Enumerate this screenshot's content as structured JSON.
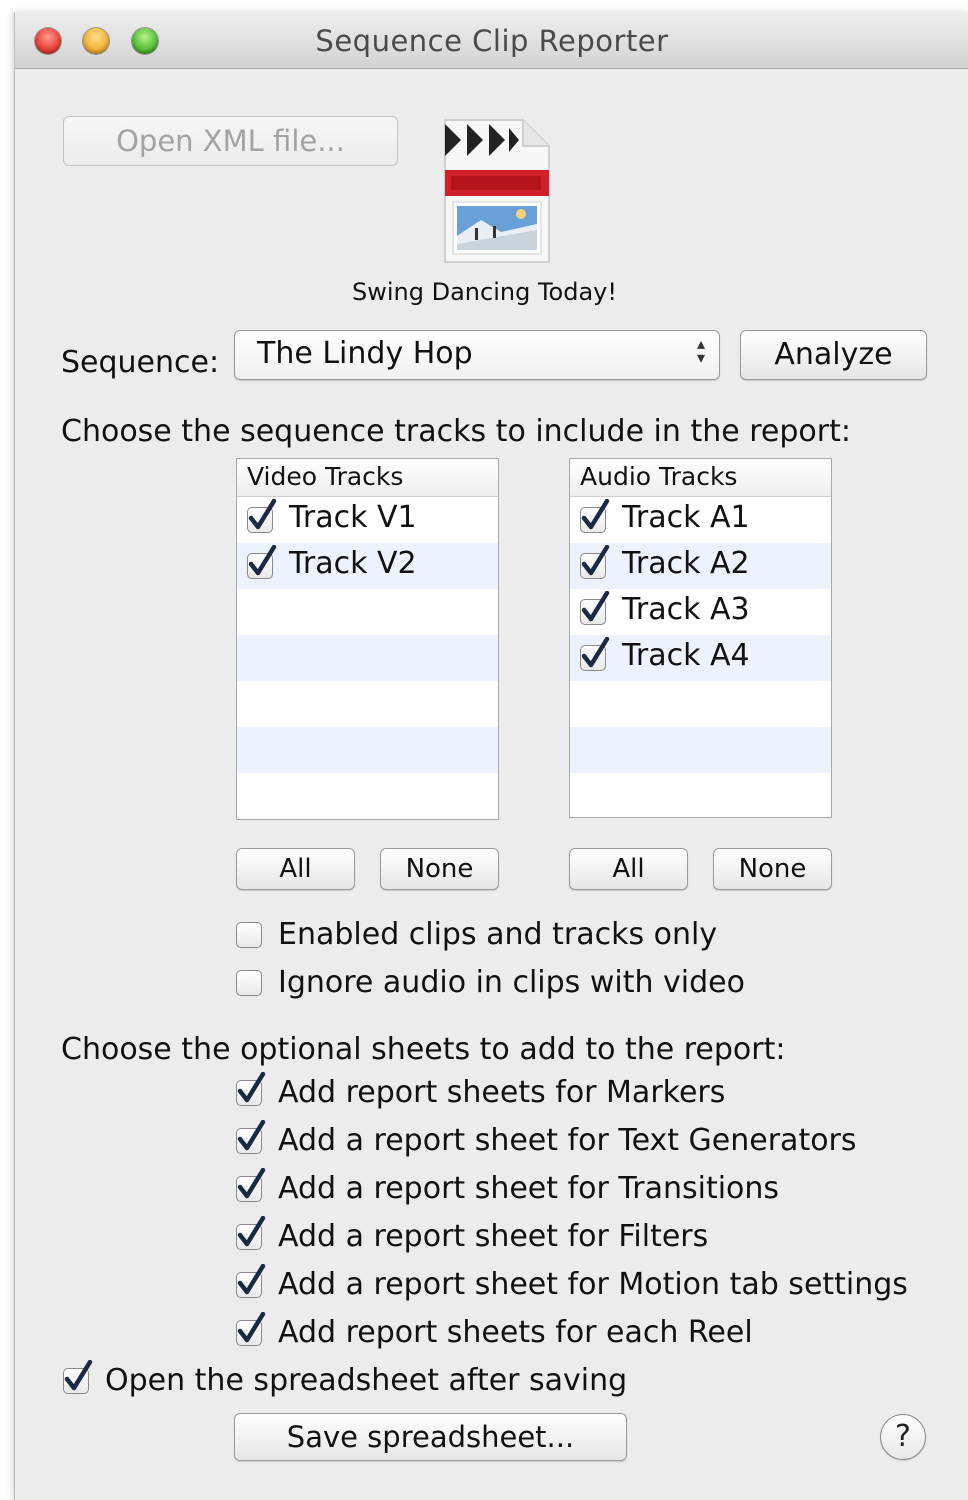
{
  "window": {
    "title": "Sequence Clip Reporter"
  },
  "open_xml_button": "Open XML file...",
  "file": {
    "name": "Swing Dancing Today!",
    "icon": "final-cut-project-file-icon"
  },
  "sequence": {
    "label": "Sequence:",
    "selected": "The Lindy Hop",
    "analyze_label": "Analyze"
  },
  "tracks_prompt": "Choose the sequence tracks to include in the report:",
  "video_tracks": {
    "header": "Video Tracks",
    "items": [
      {
        "label": "Track V1",
        "checked": true
      },
      {
        "label": "Track V2",
        "checked": true
      }
    ],
    "all_label": "All",
    "none_label": "None"
  },
  "audio_tracks": {
    "header": "Audio Tracks",
    "items": [
      {
        "label": "Track A1",
        "checked": true
      },
      {
        "label": "Track A2",
        "checked": true
      },
      {
        "label": "Track A3",
        "checked": true
      },
      {
        "label": "Track A4",
        "checked": true
      }
    ],
    "all_label": "All",
    "none_label": "None"
  },
  "options": {
    "enabled_only": {
      "label": "Enabled clips and tracks only",
      "checked": false
    },
    "ignore_audio": {
      "label": "Ignore audio in clips with video",
      "checked": false
    }
  },
  "sheets_prompt": "Choose the optional sheets to add to the report:",
  "sheets": [
    {
      "label": "Add report sheets for Markers",
      "checked": true
    },
    {
      "label": "Add a report sheet for Text Generators",
      "checked": true
    },
    {
      "label": "Add a report sheet for Transitions",
      "checked": true
    },
    {
      "label": "Add a report sheet for Filters",
      "checked": true
    },
    {
      "label": "Add a report sheet for Motion tab settings",
      "checked": true
    },
    {
      "label": "Add report sheets for each Reel",
      "checked": true
    }
  ],
  "open_after_saving": {
    "label": "Open the spreadsheet after saving",
    "checked": true
  },
  "save_button": "Save spreadsheet...",
  "help_button": "?",
  "colors": {
    "checkmark": "#1b2a44",
    "list_alt_row": "#edf3fe"
  }
}
